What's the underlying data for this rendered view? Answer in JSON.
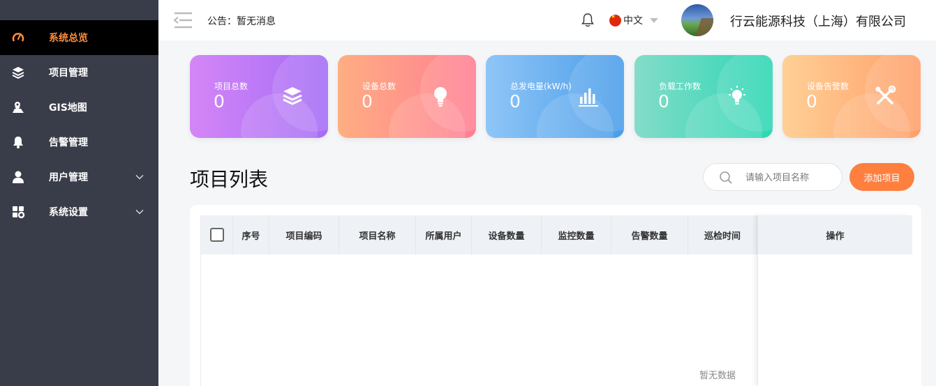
{
  "sidebar": {
    "items": [
      {
        "label": "系统总览",
        "icon": "dashboard-gauge-icon",
        "active": true
      },
      {
        "label": "项目管理",
        "icon": "layers-icon"
      },
      {
        "label": "GIS地图",
        "icon": "map-pin-icon"
      },
      {
        "label": "告警管理",
        "icon": "bell-icon"
      },
      {
        "label": "用户管理",
        "icon": "user-icon",
        "has_submenu": true
      },
      {
        "label": "系统设置",
        "icon": "settings-grid-icon",
        "has_submenu": true
      }
    ]
  },
  "header": {
    "notice": "公告：暂无消息",
    "language": "中文",
    "company": "行云能源科技（上海）有限公司"
  },
  "stats": [
    {
      "label": "项目总数",
      "value": "0",
      "icon": "layers-icon"
    },
    {
      "label": "设备总数",
      "value": "0",
      "icon": "lightbulb-icon"
    },
    {
      "label": "总发电量(kW/h)",
      "value": "0",
      "icon": "bar-chart-icon"
    },
    {
      "label": "负载工作数",
      "value": "0",
      "icon": "bulb-on-icon"
    },
    {
      "label": "设备告警数",
      "value": "0",
      "icon": "tools-icon"
    }
  ],
  "colors": {
    "sidebar_bg": "#393d49",
    "accent": "#ff7f3e",
    "active_text": "#ff8c3a"
  },
  "project_list": {
    "title": "项目列表",
    "search_placeholder": "请输入项目名称",
    "add_button": "添加项目",
    "columns": [
      "序号",
      "项目编码",
      "项目名称",
      "所属用户",
      "设备数量",
      "监控数量",
      "告警数量",
      "巡检时间"
    ],
    "action_column": "操作",
    "empty_text": "暂无数据"
  }
}
